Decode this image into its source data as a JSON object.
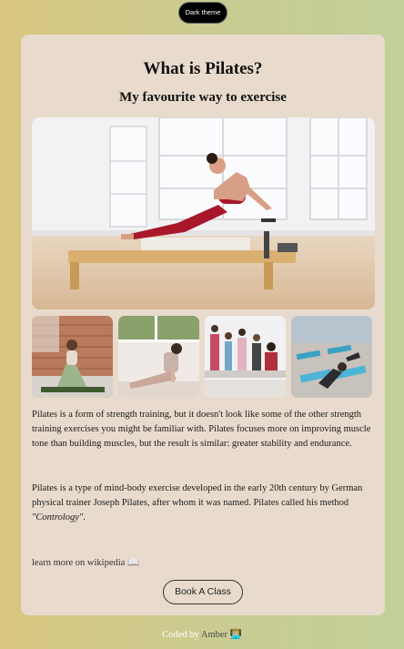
{
  "theme_toggle": {
    "label": "Dark theme"
  },
  "card": {
    "title": "What is Pilates?",
    "subtitle": "My favourite way to exercise"
  },
  "images": {
    "hero": {
      "alt": "Woman doing pilates on a reformer machine"
    },
    "thumbs": [
      {
        "alt": "Woman stretching on a mat in front of a brick wall"
      },
      {
        "alt": "Woman doing a plank on a mat"
      },
      {
        "alt": "Group pilates class on reformers"
      },
      {
        "alt": "Group mat pilates class"
      }
    ]
  },
  "paragraphs": {
    "p1": "Pilates is a form of strength training, but it doesn't look like some of the other strength training exercises you might be familiar with. Pilates focuses more on improving muscle tone than building muscles, but the result is similar: greater stability and endurance.",
    "p2_text": "Pilates is a type of mind-body exercise developed in the early 20th century by German physical trainer Joseph Pilates, after whom it was named. Pilates called his method ",
    "p2_em": "\"Contrology\"",
    "p2_end": "."
  },
  "wiki_link": {
    "label": "learn more on wikipedia 📖"
  },
  "book_button": {
    "label": "Book A Class"
  },
  "footer": {
    "prefix": "Coded by ",
    "author": "Amber 👩🏼‍💻"
  }
}
